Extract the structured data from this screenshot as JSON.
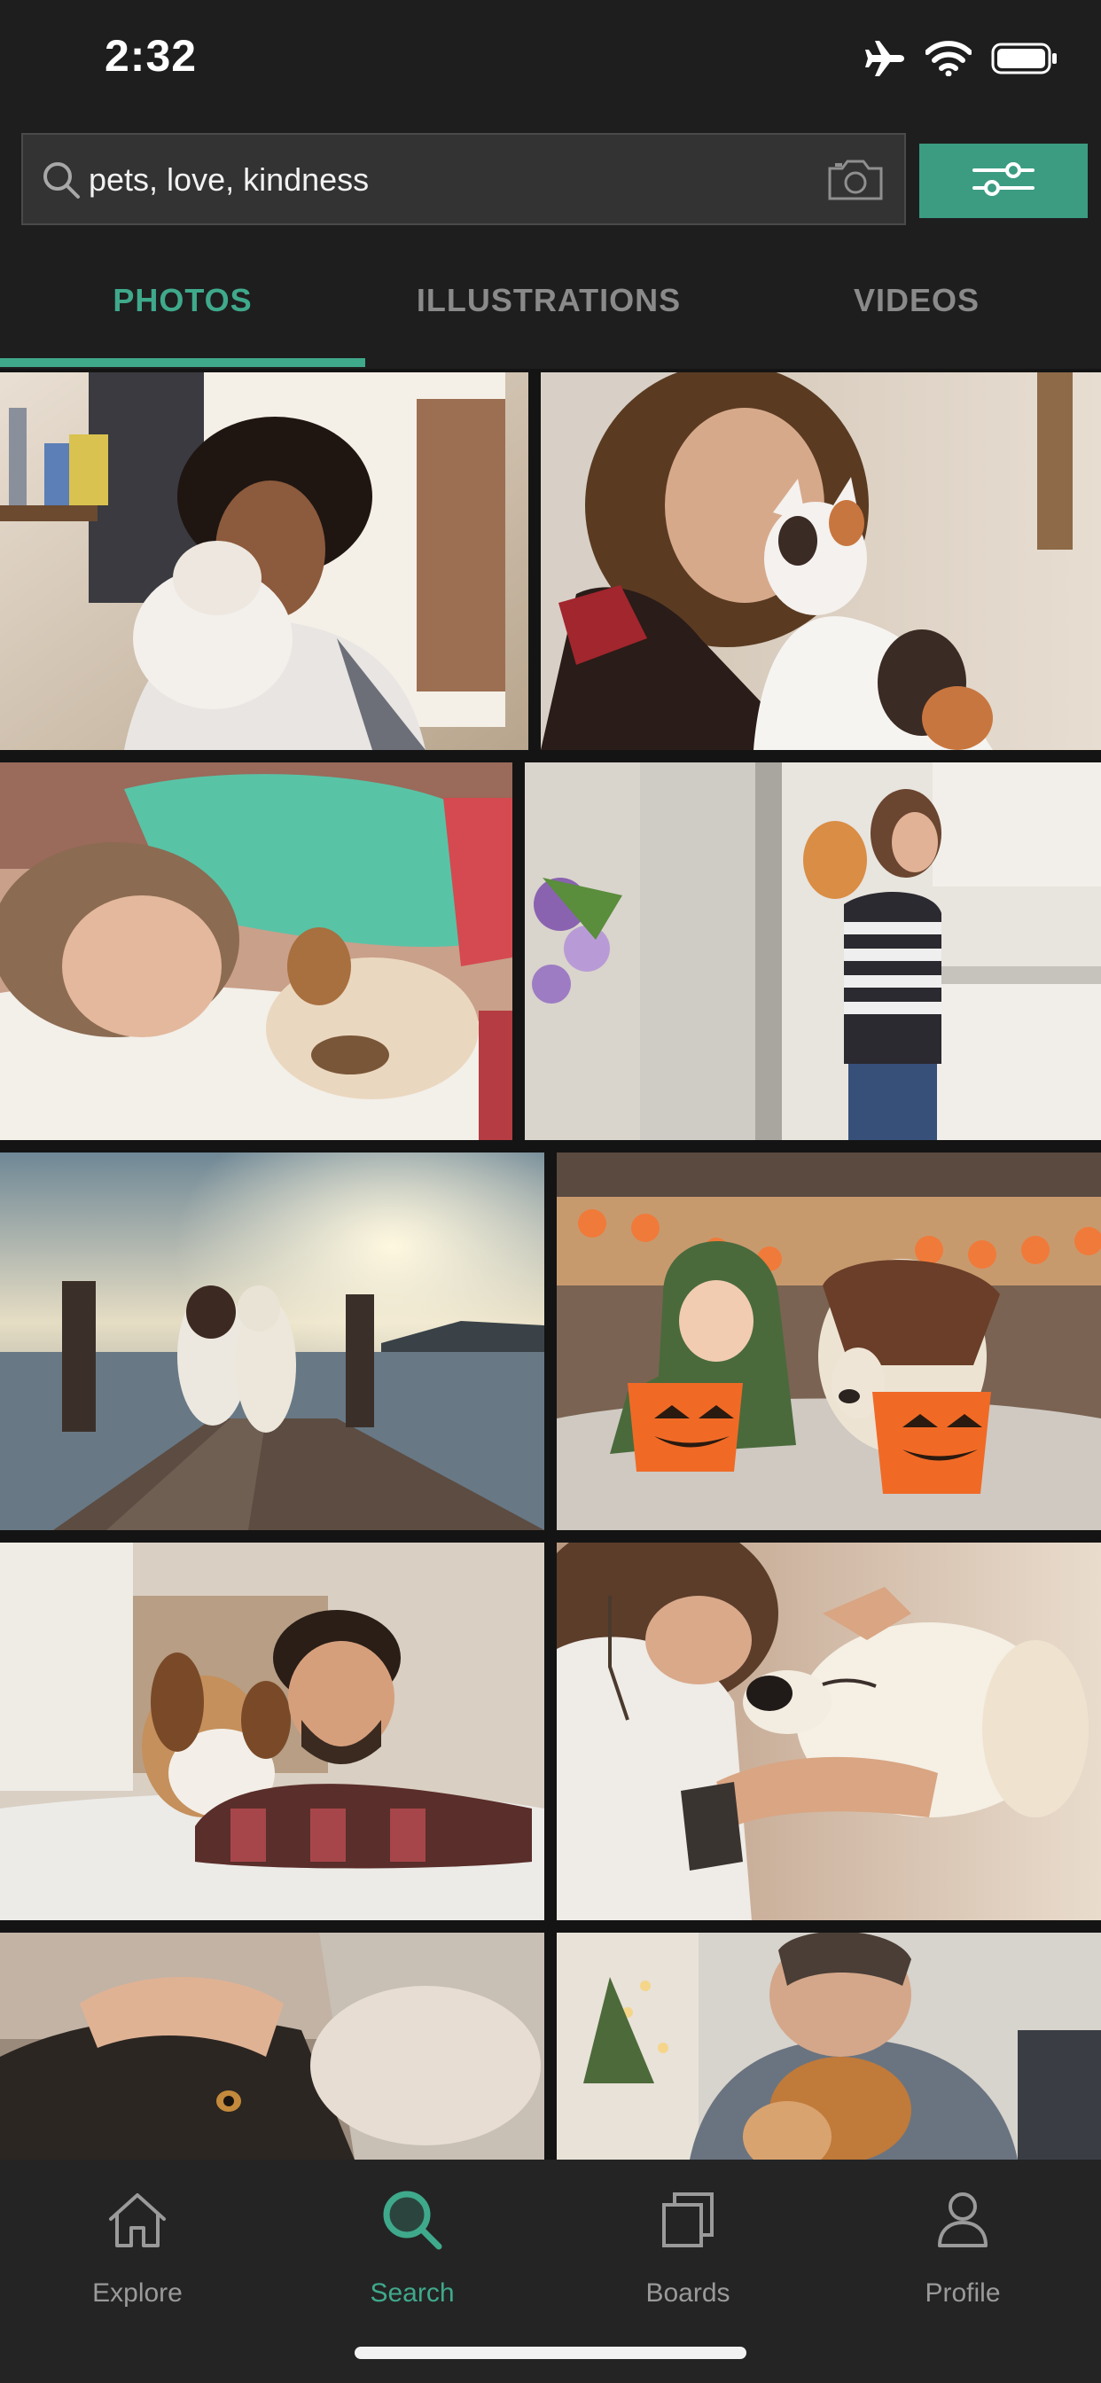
{
  "status_bar": {
    "time": "2:32",
    "icons": [
      "airplane-icon",
      "wifi-icon",
      "battery-icon"
    ]
  },
  "search": {
    "query": "pets, love, kindness",
    "camera_icon": "camera-icon",
    "filter_icon": "sliders-icon"
  },
  "tabs": [
    {
      "label": "PHOTOS",
      "active": true
    },
    {
      "label": "ILLUSTRATIONS",
      "active": false
    },
    {
      "label": "VIDEOS",
      "active": false
    }
  ],
  "bottom_nav": [
    {
      "label": "Explore",
      "icon": "home-icon",
      "active": false
    },
    {
      "label": "Search",
      "icon": "search-icon",
      "active": true
    },
    {
      "label": "Boards",
      "icon": "boards-icon",
      "active": false
    },
    {
      "label": "Profile",
      "icon": "profile-icon",
      "active": false
    }
  ],
  "colors": {
    "accent": "#3fa98b",
    "background": "#1e1e1e",
    "inactive": "#8a8a8a"
  }
}
